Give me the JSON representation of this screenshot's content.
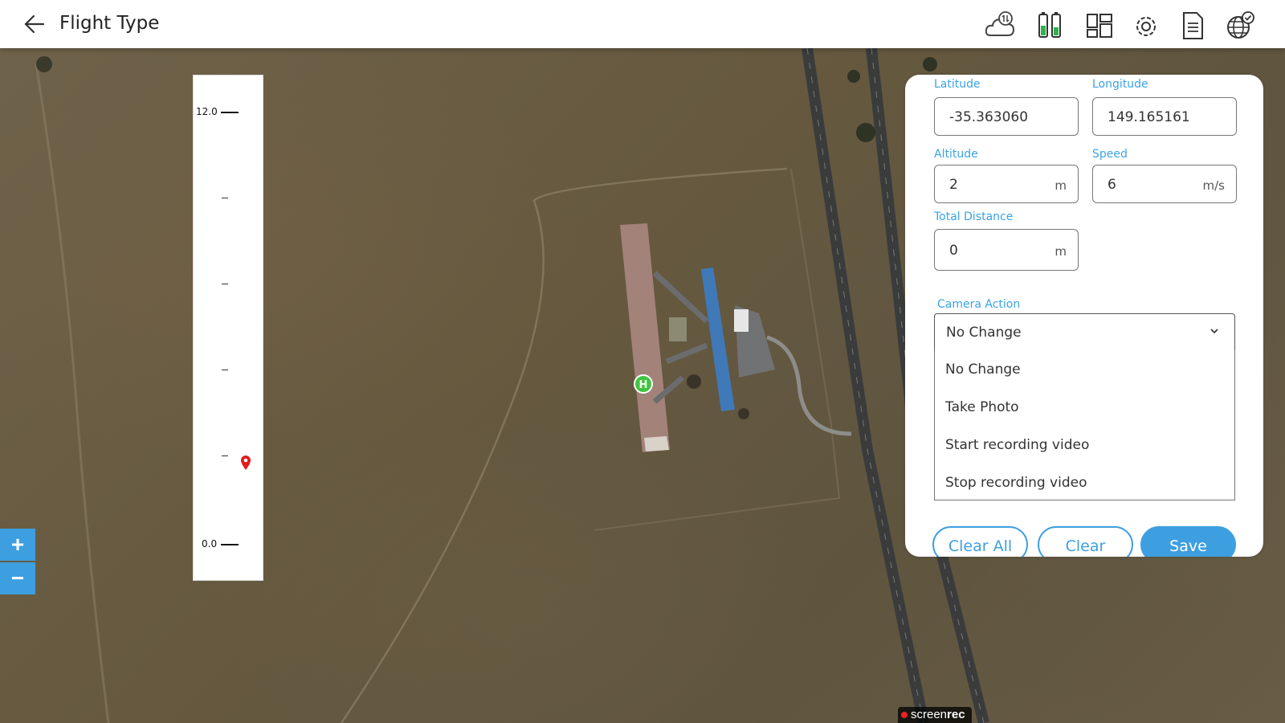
{
  "header": {
    "title": "Flight Type",
    "icons": [
      "cloud-sync-icon",
      "battery-icon",
      "dashboard-layout-icon",
      "settings-icon",
      "document-icon",
      "globe-check-icon"
    ]
  },
  "altitude_scale": {
    "max_label": "12.0",
    "min_label": "0.0"
  },
  "zoom": {
    "in": "+",
    "out": "−"
  },
  "home_marker": "H",
  "panel": {
    "latitude": {
      "label": "Latitude",
      "value": "-35.363060"
    },
    "longitude": {
      "label": "Longitude",
      "value": "149.165161"
    },
    "altitude": {
      "label": "Altitude",
      "value": "2",
      "unit": "m"
    },
    "speed": {
      "label": "Speed",
      "value": "6",
      "unit": "m/s"
    },
    "total_distance": {
      "label": "Total Distance",
      "value": "0",
      "unit": "m"
    },
    "camera_action": {
      "label": "Camera Action",
      "selected": "No Change",
      "options": [
        "No Change",
        "Take Photo",
        "Start recording video",
        "Stop recording video"
      ]
    },
    "buttons": {
      "clear_all": "Clear All",
      "clear": "Clear",
      "save": "Save"
    }
  },
  "watermark": {
    "text_a": "screen",
    "text_b": "rec"
  },
  "colors": {
    "accent": "#3d9fe0",
    "marker": "#e21b1b",
    "home": "#3fc53f"
  }
}
